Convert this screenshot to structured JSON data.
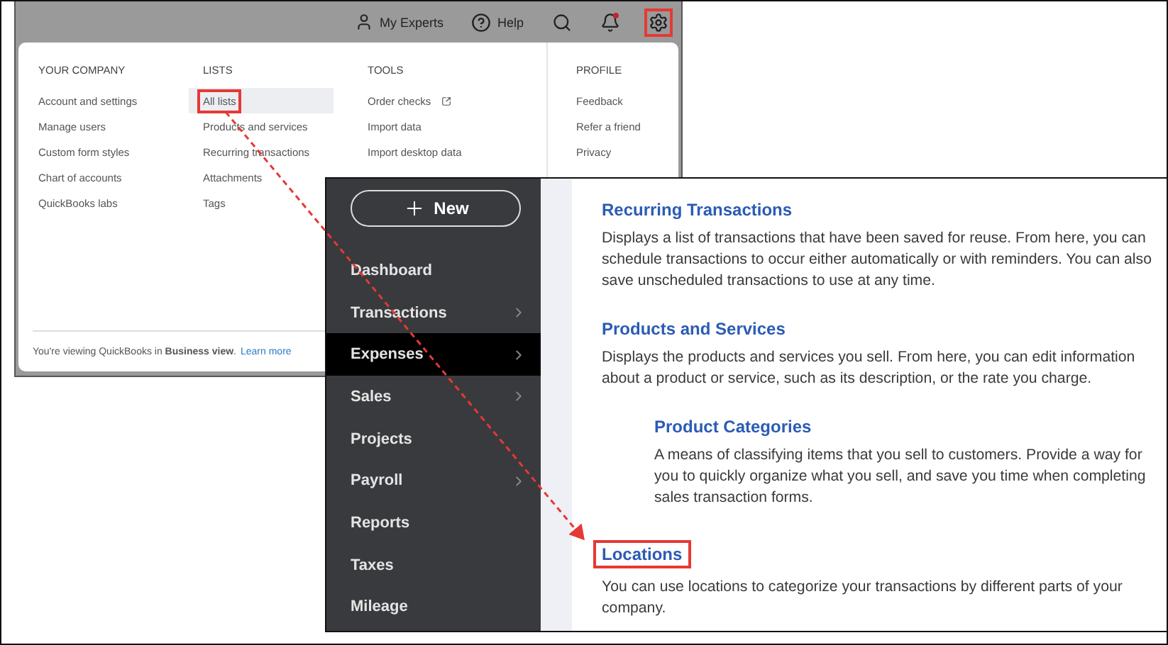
{
  "top_screen": {
    "top_bar": [
      {
        "kind": "experts",
        "label": "My Experts",
        "highlighted": false
      },
      {
        "kind": "help",
        "label": "Help",
        "highlighted": false
      },
      {
        "kind": "search",
        "highlighted": false
      },
      {
        "kind": "notifications",
        "badge": true,
        "highlighted": false
      },
      {
        "kind": "settings",
        "highlighted": true
      }
    ],
    "menu": {
      "columns": [
        {
          "heading": "YOUR COMPANY",
          "items": [
            {
              "label": "Account and settings",
              "selected": false,
              "external": false
            },
            {
              "label": "Manage users",
              "selected": false,
              "external": false
            },
            {
              "label": "Custom form styles",
              "selected": false,
              "external": false
            },
            {
              "label": "Chart of accounts",
              "selected": false,
              "external": false
            },
            {
              "label": "QuickBooks labs",
              "selected": false,
              "external": false
            }
          ]
        },
        {
          "heading": "LISTS",
          "items": [
            {
              "label": "All lists",
              "selected": true,
              "external": false
            },
            {
              "label": "Products and services",
              "selected": false,
              "external": false
            },
            {
              "label": "Recurring transactions",
              "selected": false,
              "external": false
            },
            {
              "label": "Attachments",
              "selected": false,
              "external": false
            },
            {
              "label": "Tags",
              "selected": false,
              "external": false
            }
          ]
        },
        {
          "heading": "TOOLS",
          "items": [
            {
              "label": "Order checks",
              "selected": false,
              "external": true
            },
            {
              "label": "Import data",
              "selected": false,
              "external": false
            },
            {
              "label": "Import desktop data",
              "selected": false,
              "external": false
            }
          ]
        },
        {
          "heading": "PROFILE",
          "items": [
            {
              "label": "Feedback",
              "selected": false,
              "external": false
            },
            {
              "label": "Refer a friend",
              "selected": false,
              "external": false
            },
            {
              "label": "Privacy",
              "selected": false,
              "external": false
            }
          ]
        }
      ],
      "footer": {
        "text": "You're viewing QuickBooks in **Business view**.",
        "link": "Learn more"
      }
    }
  },
  "second_screen": {
    "new_button": "New",
    "nav": [
      {
        "label": "Dashboard",
        "selected": false,
        "submenu": false
      },
      {
        "label": "Transactions",
        "selected": false,
        "submenu": true
      },
      {
        "label": "Expenses",
        "selected": true,
        "submenu": true
      },
      {
        "label": "Sales",
        "selected": false,
        "submenu": true
      },
      {
        "label": "Projects",
        "selected": false,
        "submenu": false
      },
      {
        "label": "Payroll",
        "selected": false,
        "submenu": true
      },
      {
        "label": "Reports",
        "selected": false,
        "submenu": false
      },
      {
        "label": "Taxes",
        "selected": false,
        "submenu": false
      },
      {
        "label": "Mileage",
        "selected": false,
        "submenu": false
      }
    ],
    "sections": [
      {
        "title": "Recurring Transactions",
        "description": "Displays a list of transactions that have been saved for reuse. From here, you can schedule transactions to occur either automatically or with reminders. You can also save unscheduled transactions to use at any time.",
        "indented": false,
        "highlighted": false
      },
      {
        "title": "Products and Services",
        "description": "Displays the products and services you sell. From here, you can edit information about a product or service, such as its description, or the rate you charge.",
        "indented": false,
        "highlighted": false
      },
      {
        "title": "Product Categories",
        "description": "A means of classifying items that you sell to customers. Provide a way for you to quickly organize what you sell, and save you time when completing sales transaction forms.",
        "indented": true,
        "highlighted": false
      },
      {
        "title": "Locations",
        "description": "You can use locations to categorize your transactions by different parts of your company.",
        "indented": false,
        "highlighted": true
      }
    ]
  }
}
